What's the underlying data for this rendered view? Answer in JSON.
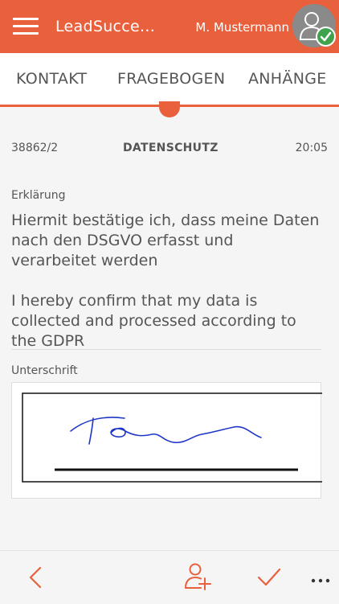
{
  "app": {
    "title": "LeadSucce...",
    "user_name": "M. Mustermann",
    "accent_color": "#e8603c",
    "status_color": "#3fa34d"
  },
  "tabs": [
    {
      "label": "KONTAKT"
    },
    {
      "label": "FRAGEBOGEN"
    },
    {
      "label": "ANHÄNGE"
    }
  ],
  "record": {
    "id": "38862/2",
    "section": "DATENSCHUTZ",
    "time": "20:05"
  },
  "declaration": {
    "label": "Erklärung",
    "text_de": "Hiermit bestätige ich, dass meine Daten nach den DSGVO erfasst und verarbeitet werden",
    "text_en": "I hereby confirm that my data is collected and processed according to the GDPR"
  },
  "signature": {
    "label": "Unterschrift"
  },
  "icons": {
    "menu": "hamburger-menu-icon",
    "avatar": "user-avatar-icon",
    "verified": "checkmark-badge-icon",
    "back": "chevron-left-icon",
    "add_contact": "add-person-icon",
    "confirm": "checkmark-icon",
    "more": "more-dots-icon"
  }
}
